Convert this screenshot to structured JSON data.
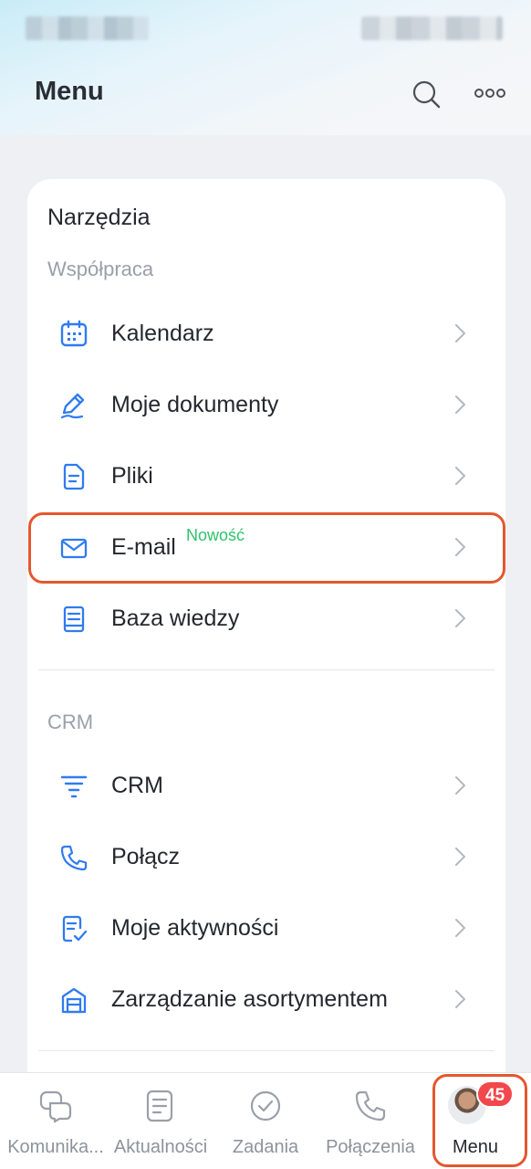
{
  "header": {
    "title": "Menu",
    "search_icon": "search-icon",
    "more_icon": "more-horizontal-icon"
  },
  "card": {
    "title": "Narzędzia",
    "sections": [
      {
        "label": "Współpraca",
        "items": [
          {
            "label": "Kalendarz",
            "icon": "calendar-icon"
          },
          {
            "label": "Moje dokumenty",
            "icon": "pen-icon"
          },
          {
            "label": "Pliki",
            "icon": "file-icon"
          },
          {
            "label": "E-mail",
            "icon": "mail-icon",
            "badge": "Nowość"
          },
          {
            "label": "Baza wiedzy",
            "icon": "book-icon"
          }
        ]
      },
      {
        "label": "CRM",
        "items": [
          {
            "label": "CRM",
            "icon": "funnel-icon"
          },
          {
            "label": "Połącz",
            "icon": "phone-icon"
          },
          {
            "label": "Moje aktywności",
            "icon": "checklist-icon"
          },
          {
            "label": "Zarządzanie asortymentem",
            "icon": "store-icon"
          }
        ]
      }
    ]
  },
  "tabbar": {
    "tabs": [
      {
        "label": "Komunika...",
        "icon": "chat-icon"
      },
      {
        "label": "Aktualności",
        "icon": "news-icon"
      },
      {
        "label": "Zadania",
        "icon": "check-circle-icon"
      },
      {
        "label": "Połączenia",
        "icon": "phone-icon"
      },
      {
        "label": "Menu",
        "icon": "avatar",
        "badge": "45",
        "active": true
      }
    ]
  },
  "colors": {
    "accent": "#2f7bf0",
    "badge_new": "#2fc26b",
    "badge_count": "#f2484b",
    "highlight": "#e4572e"
  }
}
